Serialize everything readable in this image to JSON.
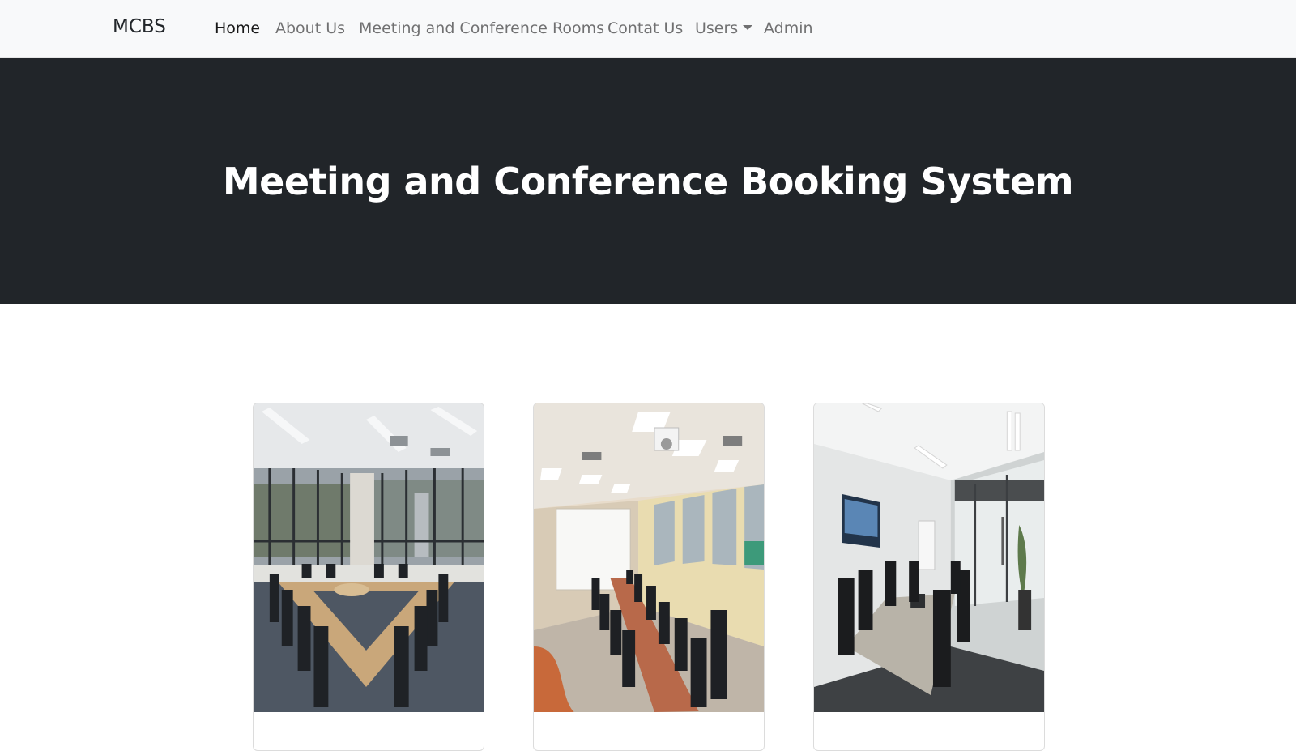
{
  "navbar": {
    "brand": "MCBS",
    "links": [
      {
        "label": "Home",
        "active": true
      },
      {
        "label": "About Us"
      },
      {
        "label": "Meeting and Conference Rooms"
      },
      {
        "label": "Contat Us"
      },
      {
        "label": "Users",
        "dropdown": true
      },
      {
        "label": "Admin"
      }
    ]
  },
  "hero": {
    "title": "Meeting and Conference Booking System",
    "background": "#212529"
  },
  "rooms": [
    {
      "image_icon": "round-table-meeting-room-photo"
    },
    {
      "image_icon": "long-table-conference-room-photo"
    },
    {
      "image_icon": "small-meeting-room-photo"
    }
  ]
}
